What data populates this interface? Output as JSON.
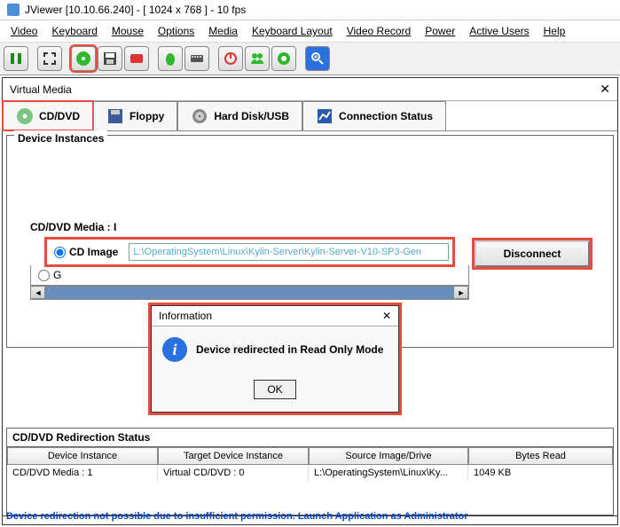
{
  "title": "JViewer [10.10.66.240] - [ 1024 x 768 ] - 10 fps",
  "menu": [
    "Video",
    "Keyboard",
    "Mouse",
    "Options",
    "Media",
    "Keyboard Layout",
    "Video Record",
    "Power",
    "Active Users",
    "Help"
  ],
  "toolbar_icons": [
    "pause",
    "fullscreen",
    "disc",
    "save",
    "rec",
    "mouse-icon",
    "keyboard-icon",
    "power-icon",
    "users-icon",
    "zoom-icon"
  ],
  "subwindow": {
    "title": "Virtual Media"
  },
  "tabs": [
    {
      "label": "CD/DVD",
      "icon": "disc"
    },
    {
      "label": "Floppy",
      "icon": "floppy"
    },
    {
      "label": "Hard Disk/USB",
      "icon": "hdd"
    },
    {
      "label": "Connection Status",
      "icon": "chart"
    }
  ],
  "device_instances_title": "Device Instances",
  "media_label": "CD/DVD Media :  I",
  "cd_image": {
    "radio_label": "CD Image",
    "path": "L:\\OperatingSystem\\Linux\\Kylin-Server\\Kylin-Server-V10-SP3-Gen"
  },
  "g_radio_label": "G",
  "disconnect_label": "Disconnect",
  "dialog": {
    "title": "Information",
    "message": "Device redirected in Read Only Mode",
    "ok": "OK"
  },
  "redir_title": "CD/DVD Redirection Status",
  "table": {
    "headers": [
      "Device Instance",
      "Target Device Instance",
      "Source Image/Drive",
      "Bytes Read"
    ],
    "rows": [
      [
        "CD/DVD Media :  1",
        "Virtual CD/DVD : 0",
        "L:\\OperatingSystem\\Linux\\Ky...",
        "1049 KB"
      ]
    ]
  },
  "footer": "Device redirection not possible due to insufficient permission. Launch Application as Administrator"
}
